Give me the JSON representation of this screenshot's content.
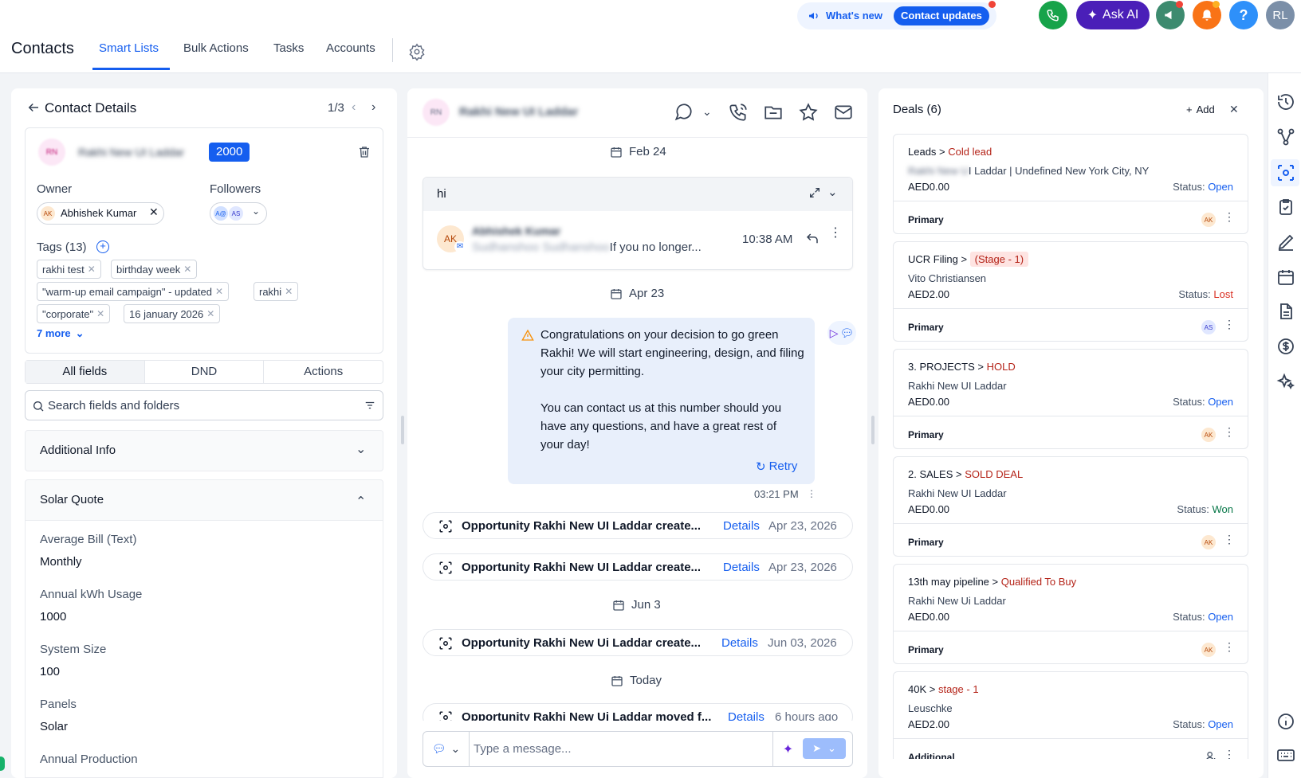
{
  "topbar": {
    "title": "Contacts",
    "tabs": [
      "Smart Lists",
      "Bulk Actions",
      "Tasks",
      "Accounts"
    ],
    "whats_new": "What's new",
    "contact_updates": "Contact updates",
    "ask_ai": "Ask AI",
    "help": "?",
    "user_initials": "RL"
  },
  "details": {
    "title": "Contact Details",
    "pager": "1/3",
    "contact_initials": "RN",
    "contact_name": "Rakhi New UI Laddar",
    "score": "2000",
    "owner_label": "Owner",
    "owner_initials": "AK",
    "owner_name": "Abhishek Kumar",
    "followers_label": "Followers",
    "follower_initials": [
      "A@",
      "AS"
    ],
    "tags_label": "Tags (13)",
    "tags": [
      "rakhi test",
      "birthday week",
      "\"warm-up email campaign\" - updated",
      "rakhi",
      "\"corporate\"",
      "16 january 2026"
    ],
    "more_tags": "7 more",
    "field_tabs": [
      "All fields",
      "DND",
      "Actions"
    ],
    "search_placeholder": "Search fields and folders",
    "sections": [
      "Additional Info",
      "Solar Quote"
    ],
    "fields": [
      {
        "label": "Average Bill (Text)",
        "value": "Monthly"
      },
      {
        "label": "Annual kWh Usage",
        "value": "1000"
      },
      {
        "label": "System Size",
        "value": "100"
      },
      {
        "label": "Panels",
        "value": "Solar"
      },
      {
        "label": "Annual Production",
        "value": ""
      }
    ]
  },
  "conversation": {
    "header_initials": "RN",
    "header_name": "Rakhi New UI Laddar",
    "date_feb": "Feb 24",
    "email_subject": "hi",
    "email_sender_initials": "AK",
    "email_sender": "Abhishek Kumar",
    "email_snippet_blur": "Sudhanshoo Sudhanshoo",
    "email_snippet": "If you no longer...",
    "email_time": "10:38 AM",
    "date_apr": "Apr 23",
    "sms_text_1": "Congratulations on your decision to go green Rakhi! We will start engineering, design, and filing your city permitting.",
    "sms_text_2": "You can contact us at this number should you have any questions, and have a great rest of your day!",
    "retry": "Retry",
    "sms_time": "03:21 PM",
    "activities": [
      {
        "text": "Opportunity Rakhi New UI Laddar create...",
        "link": "Details",
        "date": "Apr 23, 2026"
      },
      {
        "text": "Opportunity Rakhi New UI Laddar create...",
        "link": "Details",
        "date": "Apr 23, 2026"
      },
      {
        "text": "Opportunity Rakhi New Ui Laddar create...",
        "link": "Details",
        "date": "Jun 03, 2026"
      },
      {
        "text": "Opportunity Rakhi New Ui Laddar moved f...",
        "link": "Details",
        "date": "6 hours ago"
      }
    ],
    "date_jun": "Jun 3",
    "date_today": "Today",
    "composer_placeholder": "Type a message..."
  },
  "deals": {
    "title": "Deals (6)",
    "add": "Add",
    "cards": [
      {
        "pipeline": "Leads",
        "stage": "Cold lead",
        "name_blur": "Rakhi New U",
        "name": "I Laddar | Undefined New York City, NY",
        "amount": "AED0.00",
        "status_label": "Status:",
        "status": "Open",
        "role": "Primary",
        "avatar": "AK"
      },
      {
        "pipeline": "UCR Filing",
        "stage": "(Stage - 1)",
        "name": "Vito Christiansen",
        "amount": "AED2.00",
        "status_label": "Status:",
        "status": "Lost",
        "role": "Primary",
        "avatar": "AS"
      },
      {
        "pipeline": "3. PROJECTS",
        "stage": "HOLD",
        "name": "Rakhi New UI Laddar",
        "amount": "AED0.00",
        "status_label": "Status:",
        "status": "Open",
        "role": "Primary",
        "avatar": "AK"
      },
      {
        "pipeline": "2. SALES",
        "stage": "SOLD DEAL",
        "name": "Rakhi New UI Laddar",
        "amount": "AED0.00",
        "status_label": "Status:",
        "status": "Won",
        "role": "Primary",
        "avatar": "AK"
      },
      {
        "pipeline": "13th may pipeline",
        "stage": "Qualified To Buy",
        "name": "Rakhi New Ui Laddar",
        "amount": "AED0.00",
        "status_label": "Status:",
        "status": "Open",
        "role": "Primary",
        "avatar": "AK"
      },
      {
        "pipeline": "40K",
        "stage": "stage - 1",
        "name": "Leuschke",
        "amount": "AED2.00",
        "status_label": "Status:",
        "status": "Open",
        "role": "Additional",
        "avatar": ""
      }
    ]
  },
  "colors": {
    "accent": "#155eef",
    "open": "#155eef",
    "lost": "#d92d20",
    "won": "#067647",
    "stage": "#b42318",
    "ask_ai": "#4a1fb8",
    "phone": "#17a34a",
    "bell": "#f97316"
  }
}
